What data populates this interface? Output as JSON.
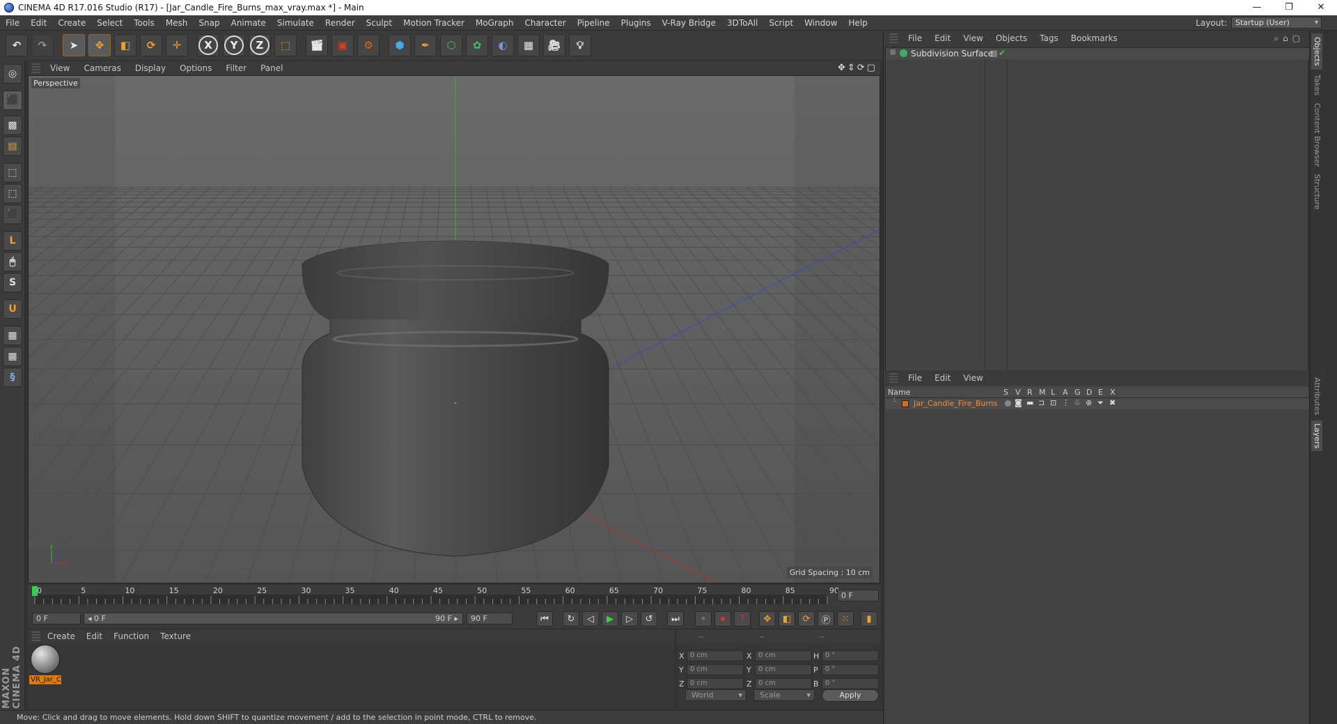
{
  "title_bar": {
    "title": "CINEMA 4D R17.016 Studio (R17) - [Jar_Candle_Fire_Burns_max_vray.max *] - Main",
    "min": "—",
    "max": "❐",
    "close": "✕"
  },
  "menubar": {
    "items": [
      "File",
      "Edit",
      "Create",
      "Select",
      "Tools",
      "Mesh",
      "Snap",
      "Animate",
      "Simulate",
      "Render",
      "Sculpt",
      "Motion Tracker",
      "MoGraph",
      "Character",
      "Pipeline",
      "Plugins",
      "V-Ray Bridge",
      "3DToAll",
      "Script",
      "Window",
      "Help"
    ],
    "layout_label": "Layout:",
    "layout_value": "Startup (User)"
  },
  "toolbar": {
    "axis_x": "X",
    "axis_y": "Y",
    "axis_z": "Z"
  },
  "viewport": {
    "menu": [
      "View",
      "Cameras",
      "Display",
      "Options",
      "Filter",
      "Panel"
    ],
    "label": "Perspective",
    "grid_spacing": "Grid Spacing : 10 cm",
    "nav_glyphs": "✥⇕⟳▢"
  },
  "timeline": {
    "ticks": [
      "0",
      "5",
      "10",
      "15",
      "20",
      "25",
      "30",
      "35",
      "40",
      "45",
      "50",
      "55",
      "60",
      "65",
      "70",
      "75",
      "80",
      "85",
      "90"
    ],
    "current_frame": "0 F",
    "start_field": "0 F",
    "range_start": "◂ 0 F",
    "range_end": "90 F ▸",
    "end_field": "90 F"
  },
  "material_panel": {
    "menu": [
      "Create",
      "Edit",
      "Function",
      "Texture"
    ],
    "material_name": "VR_Jar_C"
  },
  "coordinates": {
    "headers": [
      "--",
      "--",
      "--"
    ],
    "rows": [
      {
        "l1": "X",
        "v1": "0 cm",
        "l2": "X",
        "v2": "0 cm",
        "l3": "H",
        "v3": "0 °"
      },
      {
        "l1": "Y",
        "v1": "0 cm",
        "l2": "Y",
        "v2": "0 cm",
        "l3": "P",
        "v3": "0 °"
      },
      {
        "l1": "Z",
        "v1": "0 cm",
        "l2": "Z",
        "v2": "0 cm",
        "l3": "B",
        "v3": "0 °"
      }
    ],
    "world": "World",
    "scale": "Scale",
    "apply": "Apply"
  },
  "status_bar": {
    "text": "Move: Click and drag to move elements. Hold down SHIFT to quantize movement / add to the selection in point mode, CTRL to remove."
  },
  "object_manager": {
    "menu": [
      "File",
      "Edit",
      "View",
      "Objects",
      "Tags",
      "Bookmarks"
    ],
    "object_name": "Subdivision Surface"
  },
  "layer_manager": {
    "menu": [
      "File",
      "Edit",
      "View"
    ],
    "col_name": "Name",
    "flags": [
      "S",
      "V",
      "R",
      "M",
      "L",
      "A",
      "G",
      "D",
      "E",
      "X"
    ],
    "layer_name": "Jar_Candle_Fire_Burns"
  },
  "side_tabs": [
    "Objects",
    "Takes",
    "Content Browser",
    "Structure",
    "Attributes",
    "Layers"
  ],
  "branding": "MAXON CINEMA 4D",
  "colors": {
    "ui_bg": "#3b3b3b",
    "viewport_bg": "#5c5c5c",
    "accent_orange": "#e07a00",
    "layer_text": "#ff8c2a",
    "x_axis": "#c03030",
    "y_axis": "#30a030",
    "z_axis": "#3040c0"
  }
}
